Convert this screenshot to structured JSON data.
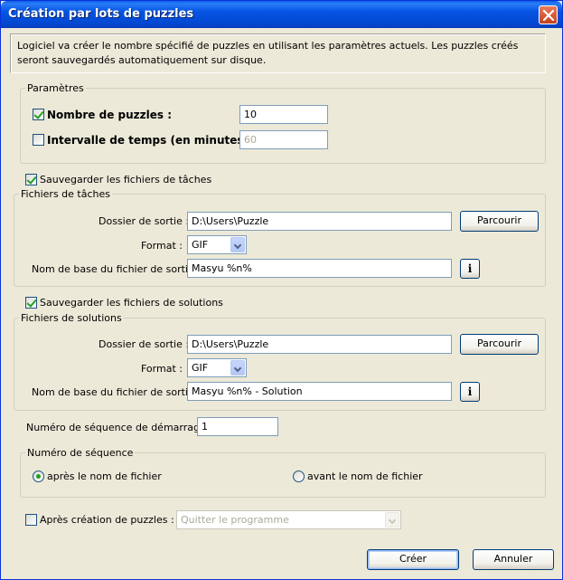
{
  "window": {
    "title": "Création par lots de puzzles",
    "close_label": "close"
  },
  "intro": "Logiciel va créer le nombre spécifié de puzzles en utilisant les paramètres actuels. Les puzzles créés seront sauvegardés automatiquement sur disque.",
  "params": {
    "legend": "Paramètres",
    "count_label": "Nombre de puzzles :",
    "count_checked": true,
    "count_value": "10",
    "interval_label": "Intervalle de temps (en minutes) :",
    "interval_checked": false,
    "interval_value": "60"
  },
  "tasks": {
    "save_label": "Sauvegarder les fichiers de tâches",
    "save_checked": true,
    "legend": "Fichiers de tâches",
    "folder_label": "Dossier de sortie :",
    "folder_value": "D:\\Users\\Puzzle",
    "browse_label": "Parcourir",
    "format_label": "Format :",
    "format_value": "GIF",
    "basename_label": "Nom de base du fichier de sortie :",
    "basename_value": "Masyu %n%",
    "info_label": "i"
  },
  "solutions": {
    "save_label": "Sauvegarder les fichiers de solutions",
    "save_checked": true,
    "legend": "Fichiers de solutions",
    "folder_label": "Dossier de sortie :",
    "folder_value": "D:\\Users\\Puzzle",
    "browse_label": "Parcourir",
    "format_label": "Format :",
    "format_value": "GIF",
    "basename_label": "Nom de base du fichier de sortie :",
    "basename_value": "Masyu %n% - Solution",
    "info_label": "i"
  },
  "sequence": {
    "start_label": "Numéro de séquence de démarrage :",
    "start_value": "1",
    "legend": "Numéro de séquence",
    "after_label": "après le nom de fichier",
    "after_selected": true,
    "before_label": "avant le nom de fichier",
    "before_selected": false
  },
  "after_creation": {
    "label": "Après création de puzzles :",
    "checked": false,
    "action_value": "Quitter le programme"
  },
  "footer": {
    "create_label": "Créer",
    "cancel_label": "Annuler"
  },
  "colors": {
    "titlebar": "#0554e3",
    "dialog_bg": "#ece9d8",
    "checkmark": "#21a121"
  }
}
